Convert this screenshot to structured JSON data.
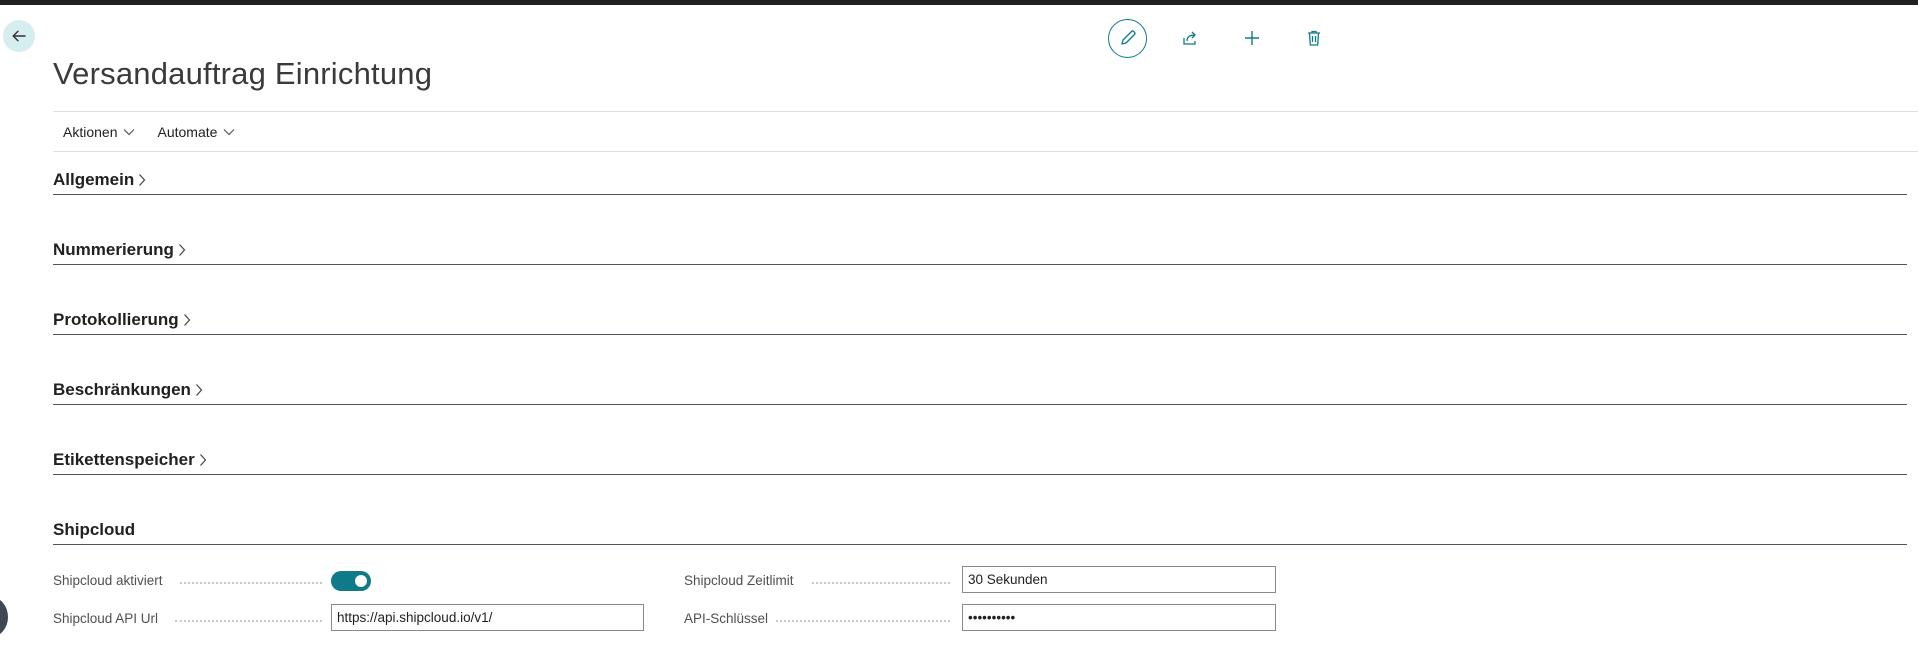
{
  "page": {
    "title": "Versandauftrag Einrichtung"
  },
  "toolbar": {
    "back_icon": "arrow-left-icon",
    "edit_icon": "pencil-icon",
    "share_icon": "share-icon",
    "new_icon": "plus-icon",
    "delete_icon": "trash-icon"
  },
  "menu": {
    "items": [
      {
        "label": "Aktionen"
      },
      {
        "label": "Automate"
      }
    ]
  },
  "sections": [
    {
      "title": "Allgemein",
      "collapsed": true
    },
    {
      "title": "Nummerierung",
      "collapsed": true
    },
    {
      "title": "Protokollierung",
      "collapsed": true
    },
    {
      "title": "Beschränkungen",
      "collapsed": true
    },
    {
      "title": "Etikettenspeicher",
      "collapsed": true
    },
    {
      "title": "Shipcloud",
      "collapsed": false
    }
  ],
  "shipcloud": {
    "activated_label": "Shipcloud aktiviert",
    "activated_value": true,
    "api_url_label": "Shipcloud API Url",
    "api_url_value": "https://api.shipcloud.io/v1/",
    "timeout_label": "Shipcloud Zeitlimit",
    "timeout_value": "30 Sekunden",
    "api_key_label": "API-Schlüssel",
    "api_key_value": "••••••••••"
  },
  "colors": {
    "accent": "#0f7b8a",
    "back_bg": "#d6eef0",
    "top_bar": "#212121"
  }
}
